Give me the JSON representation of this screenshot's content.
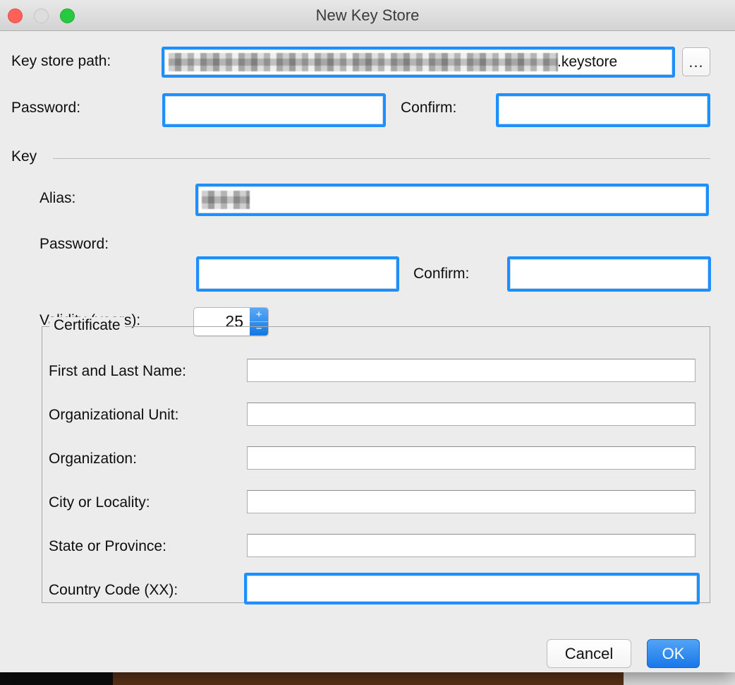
{
  "window": {
    "title": "New Key Store",
    "traffic_lights": {
      "close": "close-button",
      "minimize": "minimize-button",
      "zoom": "zoom-button"
    }
  },
  "colors": {
    "accent_blue": "#1e8fff",
    "ok_button_blue": "#1877e8",
    "window_bg": "#ececec",
    "titlebar_bg": "#d3d3d3",
    "close_red": "#ff6159",
    "minimize_gray": "#dddddd",
    "zoom_green": "#27c93f"
  },
  "keystore": {
    "path_label": "Key store path:",
    "path_value": ".keystore",
    "path_value_redacted": true,
    "browse_label": "...",
    "password_label": "Password:",
    "password_value": "",
    "confirm_label": "Confirm:",
    "confirm_value": ""
  },
  "key_section": {
    "title": "Key",
    "alias_label": "Alias:",
    "alias_value": "",
    "alias_value_redacted": true,
    "password_label": "Password:",
    "password_value": "",
    "confirm_label": "Confirm:",
    "confirm_value": "",
    "validity_label": "Validity (years):",
    "validity_value": "25",
    "stepper_increment": "+",
    "stepper_decrement": "−"
  },
  "certificate": {
    "title": "Certificate",
    "fields": [
      {
        "label": "First and Last Name:",
        "value": "",
        "focused": false
      },
      {
        "label": "Organizational Unit:",
        "value": "",
        "focused": false
      },
      {
        "label": "Organization:",
        "value": "",
        "focused": false
      },
      {
        "label": "City or Locality:",
        "value": "",
        "focused": false
      },
      {
        "label": "State or Province:",
        "value": "",
        "focused": false
      },
      {
        "label": "Country Code (XX):",
        "value": "",
        "focused": true
      }
    ]
  },
  "footer": {
    "cancel_label": "Cancel",
    "ok_label": "OK"
  }
}
